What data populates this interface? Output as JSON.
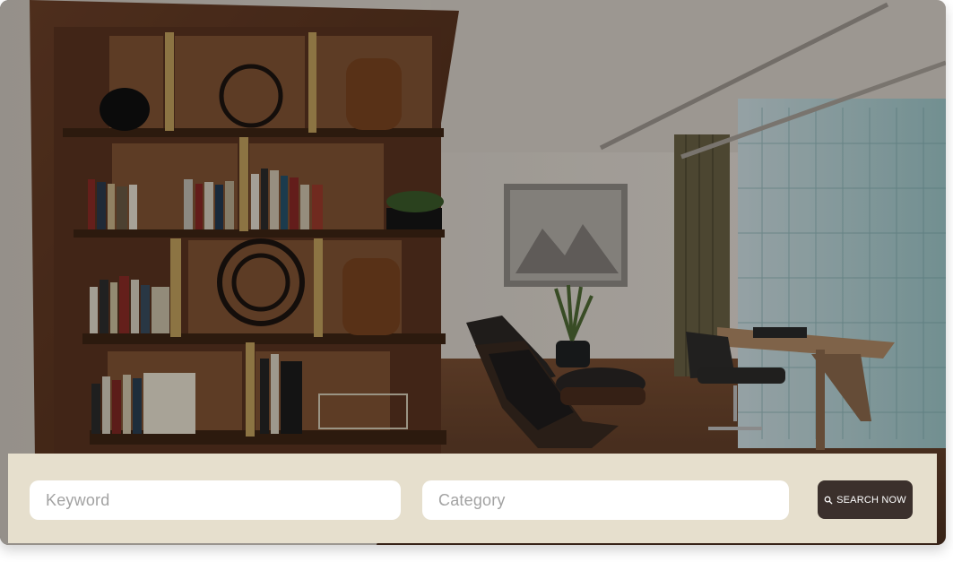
{
  "search": {
    "keyword_placeholder": "Keyword",
    "category_placeholder": "Category",
    "button_label": "SEARCH NOW",
    "button_icon": "search-icon"
  },
  "colors": {
    "panel_bg": "#e6dfcd",
    "button_bg": "#3b302c",
    "input_bg": "#ffffff",
    "placeholder_text": "#a2a2a2"
  }
}
